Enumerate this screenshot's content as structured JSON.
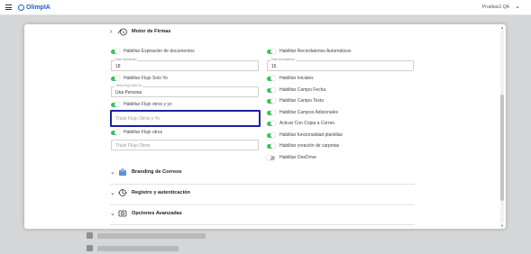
{
  "app": {
    "logo_text": "OlimpIA",
    "user_name": "Pruebas1 QA"
  },
  "sections": {
    "motor_firmas": "Motor de Firmas",
    "branding": "Branding de Correos",
    "registro": "Registro y autenticación",
    "opciones": "Opciones Avanzadas"
  },
  "left_column": {
    "expiracion_label": "Habilitar Expiración de documentos",
    "expiracion_field_label": "Días expiración",
    "expiracion_value": "18",
    "solo_yo_label": "Habilitar Flujo Solo Yo",
    "solo_yo_field_label": "Título Flujo Solo Yo",
    "solo_yo_value": "Una Persona",
    "otros_y_yo_label": "Habilitar Flujo otros y yo",
    "otros_y_yo_placeholder": "Título Flujo Otros y Yo",
    "otros_label": "Habilitar Flujo otros",
    "otros_placeholder": "Título Flujo Otros"
  },
  "right_column": {
    "recordatorios_label": "Habilitar Recordatorios Automáticos",
    "recordatorios_field_label": "Días recordatorio",
    "recordatorios_value": "15",
    "iniciales": "Habilitar Iniciales",
    "campo_fecha": "Habilitar Campo Fecha",
    "campo_texto": "Habilitar Campo Texto",
    "campos_adicionales": "Habilitar Campos Adicionales",
    "copia_correo": "Activar Con Copia a Correo",
    "plantillas": "Habilitar funcionalidad plantillas",
    "carpetas": "Habilitar creación de carpetas",
    "onedrive": "Habilitar OneDrive"
  },
  "colors": {
    "toggle_on": "#34c759",
    "toggle_off": "#b0b0b0",
    "focus_border": "#1c1fa8",
    "brand": "#1e5fc4"
  }
}
